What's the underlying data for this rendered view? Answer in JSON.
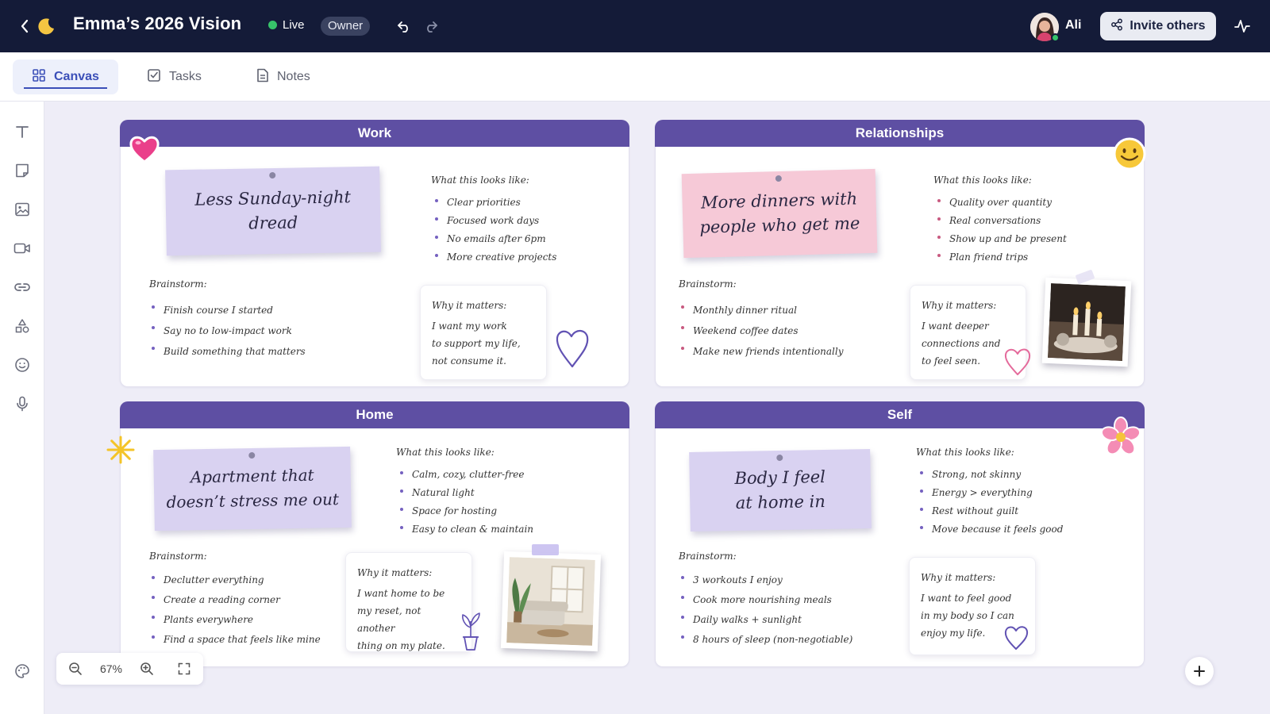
{
  "header": {
    "board_title": "Emma’s 2026 Vision",
    "live_label": "Live",
    "role_badge": "Owner",
    "user_name": "Ali",
    "invite_label": "Invite others"
  },
  "tabs": [
    {
      "label": "Canvas",
      "icon": "grid-icon",
      "active": true
    },
    {
      "label": "Tasks",
      "icon": "checkbox-icon",
      "active": false
    },
    {
      "label": "Notes",
      "icon": "document-icon",
      "active": false
    }
  ],
  "tools": [
    "text-icon",
    "sticky-note-icon",
    "image-icon",
    "video-icon",
    "link-icon",
    "shapes-icon",
    "emoji-icon",
    "microphone-icon",
    "palette-icon"
  ],
  "zoom": {
    "value": "67%"
  },
  "colors": {
    "topbar": "#141b38",
    "card_header": "#5e4fa3",
    "sticky_lavender": "#d9d2f1",
    "sticky_pink": "#f6c9d7",
    "accent": "#3b4fb8",
    "live": "#37c36a"
  },
  "cards": {
    "work": {
      "title": "Work",
      "sticky": [
        "Less Sunday-night",
        "dread"
      ],
      "looks_label": "What this looks like:",
      "looks": [
        "Clear priorities",
        "Focused work days",
        "No emails after 6pm",
        "More creative projects"
      ],
      "brainstorm_label": "Brainstorm:",
      "brainstorm": [
        "Finish course I started",
        "Say no to low-impact work",
        "Build something that matters"
      ],
      "why_label": "Why it matters:",
      "why": [
        "I want my work",
        "to support my life,",
        "not consume it."
      ]
    },
    "relationships": {
      "title": "Relationships",
      "sticky": [
        "More dinners with",
        "people who get me"
      ],
      "looks_label": "What this looks like:",
      "looks": [
        "Quality over quantity",
        "Real conversations",
        "Show up and be present",
        "Plan friend trips"
      ],
      "brainstorm_label": "Brainstorm:",
      "brainstorm": [
        "Monthly dinner ritual",
        "Weekend coffee dates",
        "Make new friends intentionally"
      ],
      "why_label": "Why it matters:",
      "why": [
        "I want deeper",
        "connections and",
        "to feel seen."
      ]
    },
    "home": {
      "title": "Home",
      "sticky": [
        "Apartment that",
        "doesn’t stress me out"
      ],
      "looks_label": "What this looks like:",
      "looks": [
        "Calm, cozy, clutter-free",
        "Natural light",
        "Space for hosting",
        "Easy to clean & maintain"
      ],
      "brainstorm_label": "Brainstorm:",
      "brainstorm": [
        "Declutter everything",
        "Create a reading corner",
        "Plants everywhere",
        "Find a space that feels like mine"
      ],
      "why_label": "Why it matters:",
      "why": [
        "I want home to be",
        "my reset, not another",
        "thing on my plate."
      ]
    },
    "self": {
      "title": "Self",
      "sticky": [
        "Body I feel",
        "at home in"
      ],
      "looks_label": "What this looks like:",
      "looks": [
        "Strong, not skinny",
        "Energy > everything",
        "Rest without guilt",
        "Move because it feels good"
      ],
      "brainstorm_label": "Brainstorm:",
      "brainstorm": [
        "3 workouts I enjoy",
        "Cook more nourishing meals",
        "Daily walks + sunlight",
        "8 hours of sleep (non-negotiable)"
      ],
      "why_label": "Why it matters:",
      "why": [
        "I want to feel good",
        "in my body so I can",
        "enjoy my life."
      ]
    }
  }
}
